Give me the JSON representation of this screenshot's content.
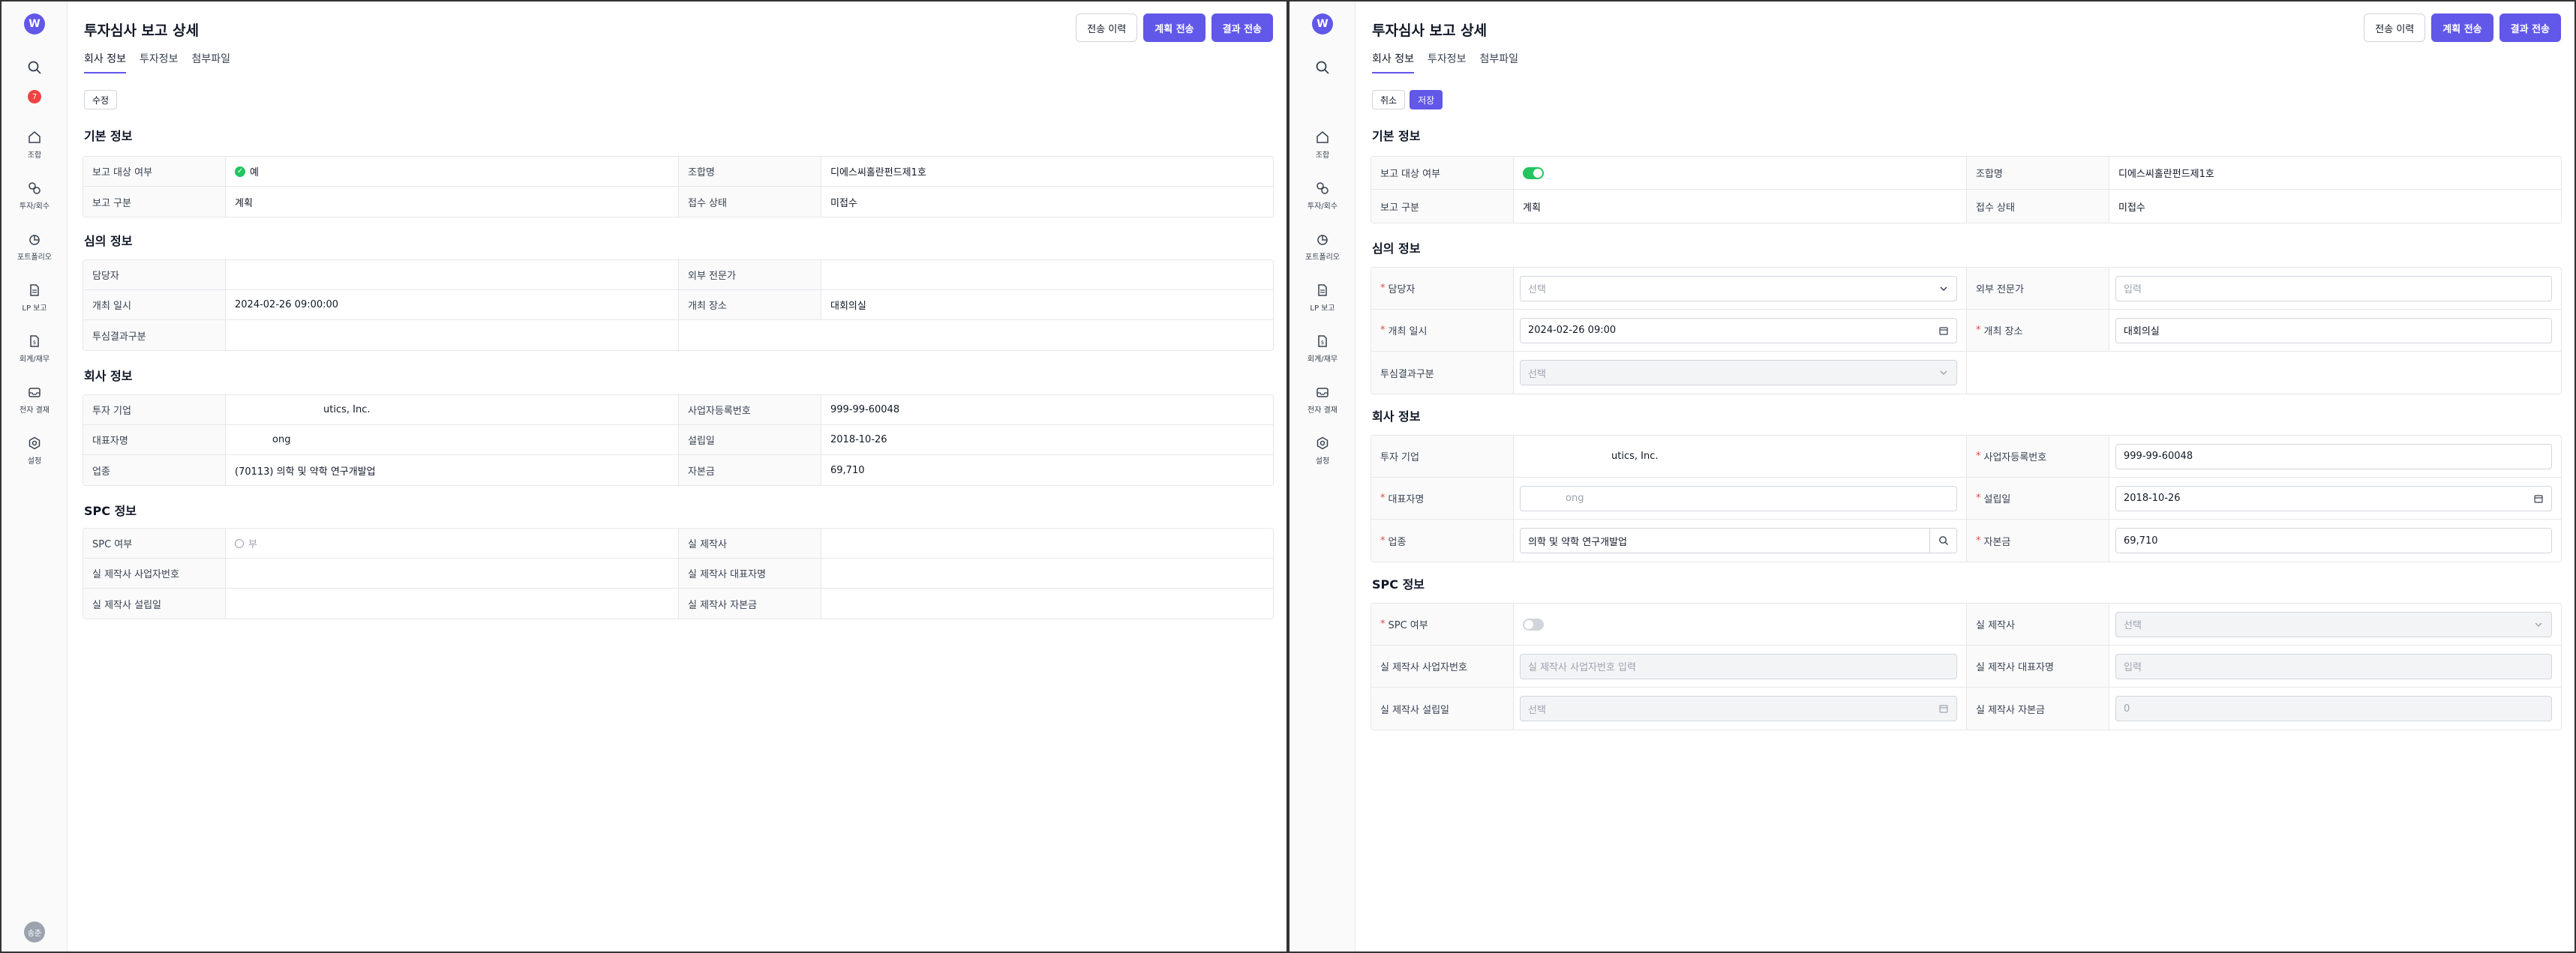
{
  "app": {
    "logo_letter": "W",
    "search_badge": "7",
    "avatar_label": "송준",
    "nav": [
      {
        "label": "조합",
        "icon": "home-icon"
      },
      {
        "label": "투자/회수",
        "icon": "exchange-icon"
      },
      {
        "label": "포트폴리오",
        "icon": "pie-chart-icon"
      },
      {
        "label": "LP 보고",
        "icon": "document-icon"
      },
      {
        "label": "회계/재무",
        "icon": "finance-document-icon"
      },
      {
        "label": "전자 결재",
        "icon": "inbox-icon"
      },
      {
        "label": "설정",
        "icon": "gear-icon"
      }
    ]
  },
  "header": {
    "title": "투자심사 보고 상세",
    "btn_history": "전송 이력",
    "btn_plan_send": "계획 전송",
    "btn_result_send": "결과 전송"
  },
  "tabs": [
    "회사 정보",
    "투자정보",
    "첨부파일"
  ],
  "view": {
    "edit_label": "수정",
    "sections": {
      "basic": "기본 정보",
      "review": "심의 정보",
      "company": "회사 정보",
      "spc": "SPC 정보"
    },
    "basic": {
      "report_target_label": "보고 대상 여부",
      "report_target_value": "예",
      "fund_name_label": "조합명",
      "fund_name_value": "디에스씨홀란펀드제1호",
      "report_type_label": "보고 구분",
      "report_type_value": "계획",
      "receipt_status_label": "접수 상태",
      "receipt_status_value": "미접수"
    },
    "review": {
      "manager_label": "담당자",
      "manager_value": "",
      "external_expert_label": "외부 전문가",
      "external_expert_value": "",
      "meeting_date_label": "개최 일시",
      "meeting_date_value": "2024-02-26 09:00:00",
      "meeting_place_label": "개최 장소",
      "meeting_place_value": "대회의실",
      "result_type_label": "투심결과구분",
      "result_type_value": ""
    },
    "company": {
      "investee_label": "투자 기업",
      "investee_value": "utics, Inc.",
      "biz_reg_label": "사업자등록번호",
      "biz_reg_value": "999-99-60048",
      "ceo_label": "대표자명",
      "ceo_value": "ong",
      "founded_label": "설립일",
      "founded_value": "2018-10-26",
      "industry_label": "업종",
      "industry_value": "(70113) 의학 및 약학 연구개발업",
      "capital_label": "자본금",
      "capital_value": "69,710"
    },
    "spc": {
      "spc_label": "SPC 여부",
      "spc_value": "부",
      "actual_company_label": "실 제작사",
      "actual_company_value": "",
      "actual_biz_reg_label": "실 제작사 사업자번호",
      "actual_biz_reg_value": "",
      "actual_ceo_label": "실 제작사 대표자명",
      "actual_ceo_value": "",
      "actual_founded_label": "실 제작사 설립일",
      "actual_founded_value": "",
      "actual_capital_label": "실 제작사 자본금",
      "actual_capital_value": ""
    }
  },
  "edit": {
    "cancel_label": "취소",
    "save_label": "저장",
    "manager_placeholder": "선택",
    "external_expert_placeholder": "입력",
    "meeting_date_value": "2024-02-26 09:00",
    "meeting_place_value": "대회의실",
    "result_type_placeholder": "선택",
    "investee_value": "utics, Inc.",
    "biz_reg_value": "999-99-60048",
    "ceo_value": "ong",
    "founded_value": "2018-10-26",
    "industry_value": "의학 및 약학 연구개발업",
    "capital_value": "69,710",
    "actual_company_placeholder": "선택",
    "actual_biz_reg_placeholder": "실 제작사 사업자번호 입력",
    "actual_ceo_placeholder": "입력",
    "actual_founded_placeholder": "선택",
    "actual_capital_placeholder": "0"
  },
  "colors": {
    "primary": "#6157e8",
    "success": "#22c55e",
    "danger": "#ef4444"
  }
}
